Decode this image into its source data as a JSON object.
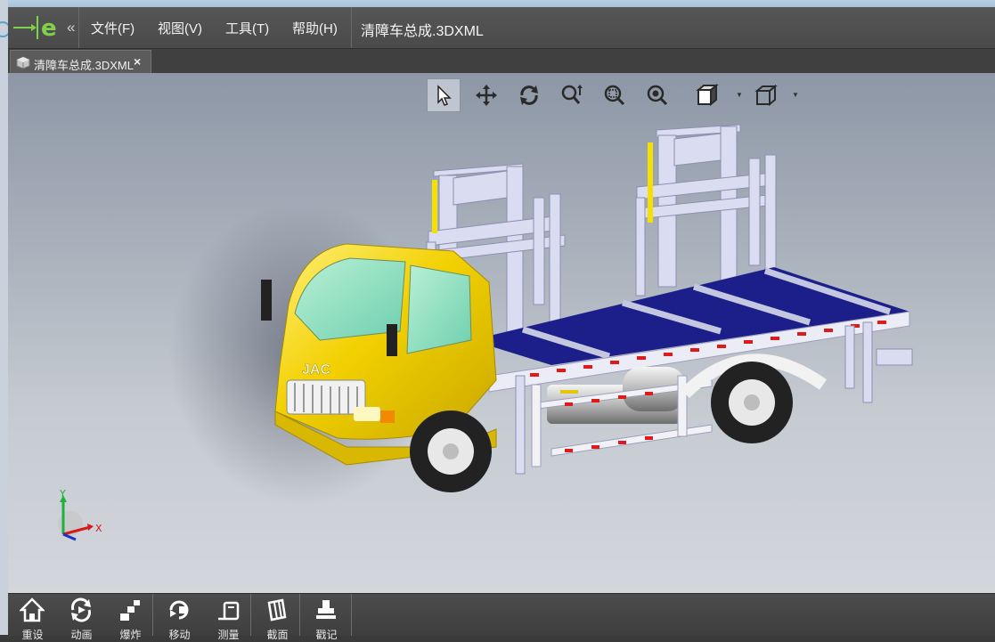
{
  "menubar": {
    "menus": [
      "文件(F)",
      "视图(V)",
      "工具(T)",
      "帮助(H)"
    ],
    "document_title": "清障车总成.3DXML"
  },
  "tabs": [
    {
      "label": "清障车总成.3DXML",
      "close": "×"
    }
  ],
  "toolbar": {
    "tools": [
      "select-arrow-icon",
      "pan-move-icon",
      "rotate-icon",
      "zoom-icon",
      "zoom-box-icon",
      "zoom-fit-icon",
      "render-mode-icon",
      "view-cube-icon"
    ],
    "active": "select-arrow-icon"
  },
  "triad": {
    "y": "Y",
    "x": "X"
  },
  "truck": {
    "badge": "JAC"
  },
  "bottom_toolbar": {
    "buttons": [
      "重设",
      "动画",
      "爆炸",
      "移动",
      "测量",
      "截面",
      "戳记"
    ]
  },
  "colors": {
    "menubar": "#4f4f4f",
    "cab": "#f2d000",
    "deck": "#1c1f8a",
    "frame": "#d9dcf0"
  }
}
